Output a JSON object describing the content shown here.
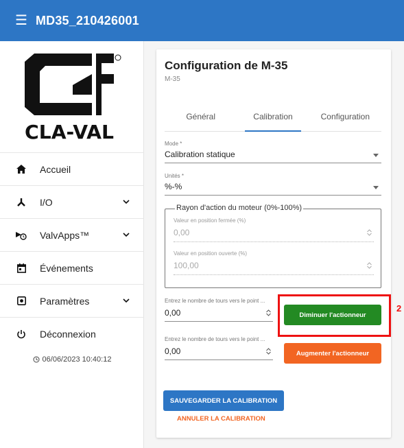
{
  "header": {
    "title": "MD35_210426001",
    "menu_icon": "hamburger-menu-icon"
  },
  "brand": {
    "logo_text": "CLA-VAL",
    "colors": {
      "header": "#2d76c5",
      "logo": "#111111"
    }
  },
  "sidebar": {
    "items": [
      {
        "label": "Accueil",
        "icon": "home-icon",
        "expandable": false
      },
      {
        "label": "I/O",
        "icon": "io-icon",
        "expandable": true
      },
      {
        "label": "ValvApps™",
        "icon": "valvapps-icon",
        "expandable": true
      },
      {
        "label": "Événements",
        "icon": "calendar-icon",
        "expandable": false
      },
      {
        "label": "Paramètres",
        "icon": "settings-icon",
        "expandable": true
      },
      {
        "label": "Déconnexion",
        "icon": "power-icon",
        "expandable": false
      }
    ],
    "timestamp": "06/06/2023 10:40:12"
  },
  "card": {
    "title": "Configuration de M-35",
    "subtitle": "M-35",
    "tabs": [
      {
        "label": "Général",
        "active": false
      },
      {
        "label": "Calibration",
        "active": true
      },
      {
        "label": "Configuration",
        "active": false
      }
    ],
    "mode": {
      "label": "Mode *",
      "value": "Calibration statique"
    },
    "units": {
      "label": "Unités *",
      "value": "%-%"
    },
    "range": {
      "legend": "Rayon d'action du moteur (0%-100%)",
      "closed": {
        "label": "Valeur en position fermée (%)",
        "value": "0,00"
      },
      "open": {
        "label": "Valeur en position ouverte (%)",
        "value": "100,00"
      }
    },
    "turns1": {
      "label": "Entrez le nombre de tours vers le point ...",
      "value": "0,00"
    },
    "turns2": {
      "label": "Entrez le nombre de tours vers le point ...",
      "value": "0,00"
    },
    "buttons": {
      "decrease": "Diminuer l'actionneur",
      "increase": "Augmenter l'actionneur",
      "save": "SAUVEGARDER LA CALIBRATION",
      "cancel": "ANNULER LA CALIBRATION"
    }
  },
  "annotation": {
    "marker": "2",
    "color": "#e11111"
  }
}
